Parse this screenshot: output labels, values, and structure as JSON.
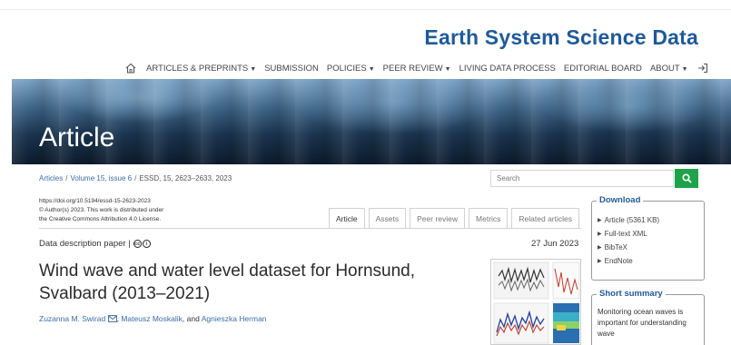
{
  "header": {
    "journal_title": "Earth System Science Data"
  },
  "nav": {
    "items": [
      {
        "label": "ARTICLES & PREPRINTS",
        "dropdown": true
      },
      {
        "label": "SUBMISSION",
        "dropdown": false
      },
      {
        "label": "POLICIES",
        "dropdown": true
      },
      {
        "label": "PEER REVIEW",
        "dropdown": true
      },
      {
        "label": "LIVING DATA PROCESS",
        "dropdown": false
      },
      {
        "label": "EDITORIAL BOARD",
        "dropdown": false
      },
      {
        "label": "ABOUT",
        "dropdown": true
      }
    ],
    "icons": {
      "home": "home-icon",
      "login": "login-icon"
    }
  },
  "banner": {
    "title": "Article"
  },
  "breadcrumb": {
    "items": [
      "Articles",
      "Volume 15, issue 6",
      "ESSD, 15, 2623–2633, 2023"
    ],
    "separator": "/"
  },
  "search": {
    "placeholder": "Search"
  },
  "meta": {
    "doi": "https://doi.org/10.5194/essd-15-2623-2023",
    "copyright": "© Author(s) 2023. This work is distributed under",
    "license": "the Creative Commons Attribution 4.0 License."
  },
  "tabs": [
    "Article",
    "Assets",
    "Peer review",
    "Metrics",
    "Related articles"
  ],
  "active_tab": "Article",
  "paper": {
    "type": "Data description paper |",
    "date": "27 Jun 2023",
    "title": "Wind wave and water level dataset for Hornsund, Svalbard (2013–2021)",
    "authors": [
      "Zuzanna M. Swirad",
      "Mateusz Moskalik",
      "Agnieszka Herman"
    ],
    "author_sep": ", ",
    "author_and": ", and "
  },
  "download": {
    "legend": "Download",
    "items": [
      "Article (5361 KB)",
      "Full-text XML",
      "BibTeX",
      "EndNote"
    ]
  },
  "summary": {
    "legend": "Short summary",
    "text": "Monitoring ocean waves is important for understanding wave"
  },
  "colors": {
    "brand": "#1f5a99",
    "link": "#3a6ea5",
    "search_button": "#1fa34a"
  }
}
